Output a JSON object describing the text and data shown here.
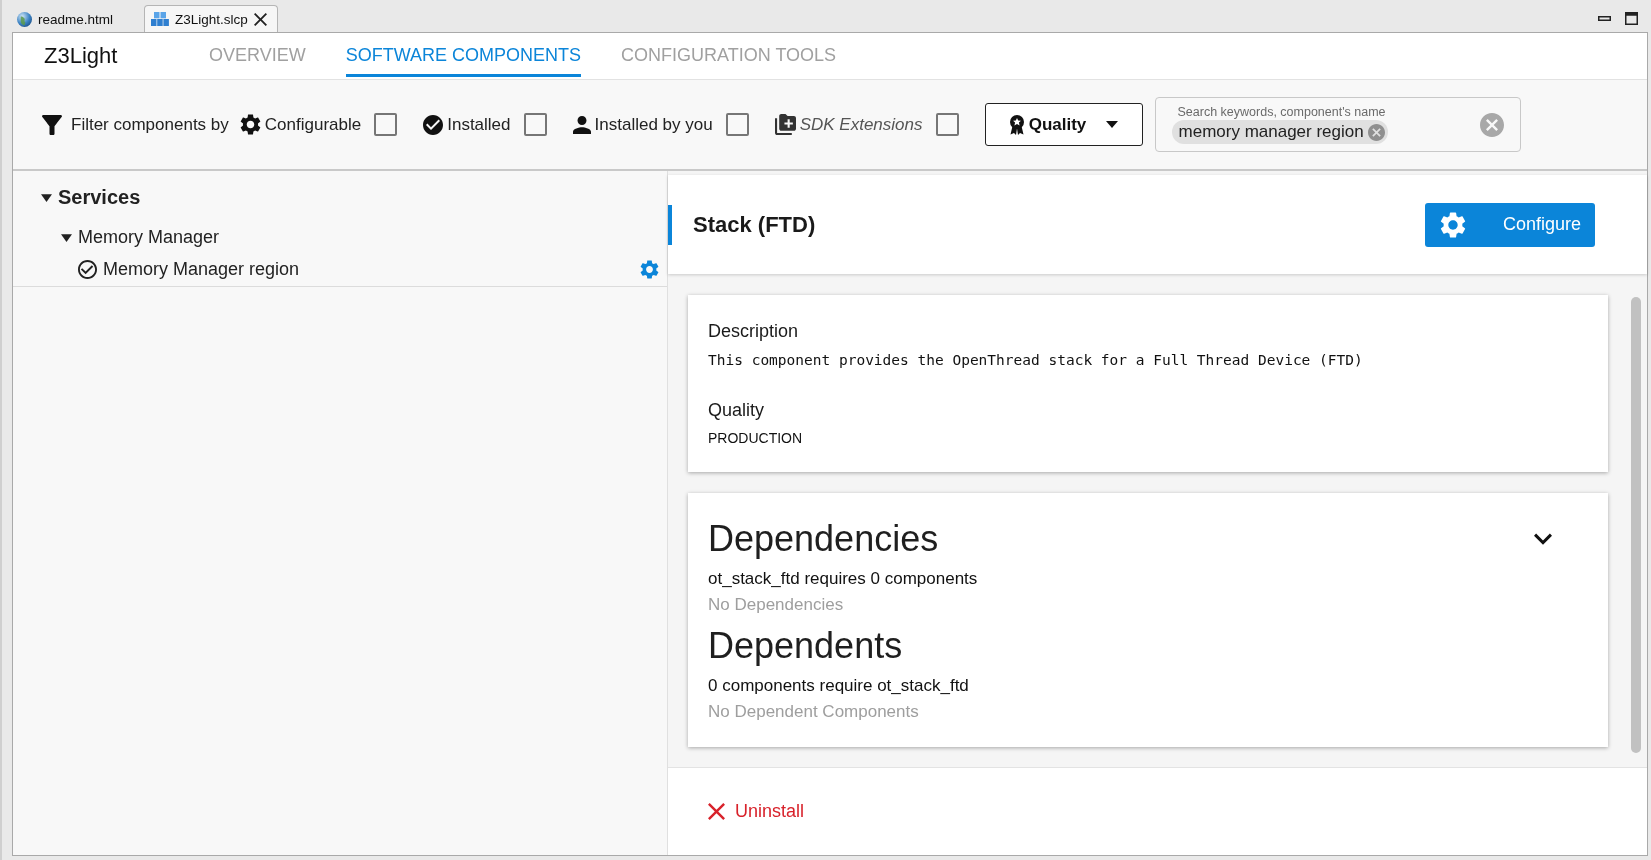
{
  "editor_tabs": [
    {
      "label": "readme.html",
      "kind": "web_page",
      "selected": false
    },
    {
      "label": "Z3Light.slcp",
      "kind": "project",
      "selected": true
    }
  ],
  "project_title": "Z3Light",
  "page_tabs": [
    {
      "label": "OVERVIEW",
      "selected": false
    },
    {
      "label": "SOFTWARE COMPONENTS",
      "selected": true
    },
    {
      "label": "CONFIGURATION TOOLS",
      "selected": false
    }
  ],
  "filter_bar": {
    "label": "Filter components by",
    "filters": [
      {
        "kind": "configurable",
        "label": "Configurable",
        "checked": false
      },
      {
        "kind": "installed",
        "label": "Installed",
        "checked": false
      },
      {
        "kind": "installed_by_you",
        "label": "Installed by you",
        "checked": false
      },
      {
        "kind": "sdk_extensions",
        "label": "SDK Extensions",
        "checked": false
      }
    ],
    "quality_button": "Quality",
    "search": {
      "label": "Search keywords, component's name",
      "chips": [
        "memory manager region"
      ]
    }
  },
  "component_tree": [
    {
      "label": "Services",
      "expanded": true,
      "children": [
        {
          "label": "Memory Manager",
          "expanded": true,
          "children": [
            {
              "label": "Memory Manager region",
              "installed": true,
              "configurable": true
            }
          ]
        }
      ]
    }
  ],
  "details": {
    "title": "Stack (FTD)",
    "configure_button": "Configure",
    "info_card": [
      {
        "kind": "mono",
        "heading": "Description",
        "text": "This component provides the OpenThread stack for a Full Thread Device (FTD)"
      },
      {
        "kind": "plain",
        "heading": "Quality",
        "text": "PRODUCTION"
      }
    ],
    "dependency_sections": [
      {
        "heading": "Dependencies",
        "summary": "ot_stack_ftd requires 0 components",
        "empty_text": "No Dependencies"
      },
      {
        "heading": "Dependents",
        "summary": "0 components require ot_stack_ftd",
        "empty_text": "No Dependent Components"
      }
    ],
    "uninstall_button": "Uninstall"
  }
}
